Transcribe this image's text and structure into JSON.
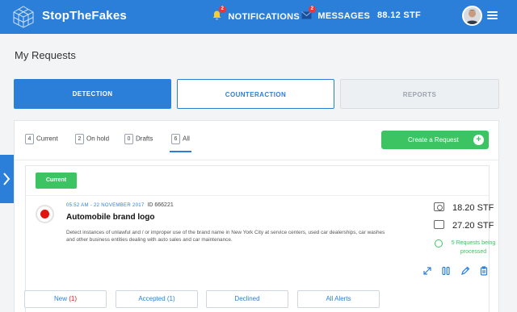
{
  "header": {
    "brand": "StopTheFakes",
    "notifications": {
      "label": "NOTIFICATIONS",
      "badge": "2"
    },
    "messages": {
      "label": "MESSAGES",
      "badge": "2"
    },
    "balance": "88.12 STF"
  },
  "page": {
    "title": "My Requests"
  },
  "main_tabs": [
    {
      "label": "DETECTION",
      "state": "active"
    },
    {
      "label": "COUNTERACTION",
      "state": "outlined"
    },
    {
      "label": "REPORTS",
      "state": "disabled"
    }
  ],
  "filters": [
    {
      "count": "4",
      "label": "Current"
    },
    {
      "count": "2",
      "label": "On hold"
    },
    {
      "count": "0",
      "label": "Drafts"
    },
    {
      "count": "6",
      "label": "All",
      "active": true
    }
  ],
  "create_button": {
    "label": "Create a Request",
    "icon": "plus-icon"
  },
  "request": {
    "tag": "Current",
    "datetime": "05:52 AM - 22 NOVEMBER 2017",
    "id": "ID 666221",
    "title": "Automobile brand logo",
    "description": "Detect instances of unlawful and / or improper use of the brand name in New York City at service centers, used car dealerships, car washes and other business entities dealing with auto sales and car maintenance.",
    "price_photo": "18.20 STF",
    "price_video": "27.20 STF",
    "processing": "5 Requests being processed"
  },
  "bottom_tabs": {
    "new": {
      "label": "New",
      "count": "(1)"
    },
    "accepted": "Accepted (1)",
    "declined": "Declined",
    "all_alerts": "All Alerts"
  },
  "colors": {
    "primary": "#2b7fd8",
    "success": "#3cc463",
    "danger": "#e3140f",
    "background": "#f3f4f6"
  }
}
